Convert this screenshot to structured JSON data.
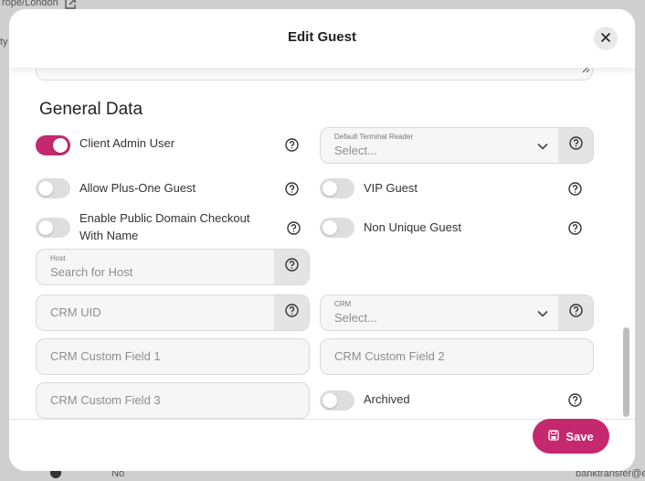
{
  "background": {
    "timezone": "rope/London",
    "column_fragment": "ty",
    "no_label": "No",
    "email_fragment": "banktransfer@e"
  },
  "modal": {
    "title": "Edit Guest",
    "section_title": "General Data"
  },
  "fields": {
    "client_admin_user": {
      "label": "Client Admin User",
      "on": true
    },
    "default_terminal_reader": {
      "label": "Default Terminal Reader",
      "placeholder": "Select..."
    },
    "allow_plus_one": {
      "label": "Allow Plus-One Guest",
      "on": false
    },
    "vip_guest": {
      "label": "VIP Guest",
      "on": false
    },
    "enable_public_domain_checkout": {
      "label": "Enable Public Domain Checkout With Name",
      "on": false
    },
    "non_unique_guest": {
      "label": "Non Unique Guest",
      "on": false
    },
    "host": {
      "label": "Host",
      "placeholder": "Search for Host"
    },
    "crm_uid": {
      "placeholder": "CRM UID"
    },
    "crm": {
      "label": "CRM",
      "placeholder": "Select..."
    },
    "crm_custom_field_1": {
      "placeholder": "CRM Custom Field 1"
    },
    "crm_custom_field_2": {
      "placeholder": "CRM Custom Field 2"
    },
    "crm_custom_field_3": {
      "placeholder": "CRM Custom Field 3"
    },
    "archived": {
      "label": "Archived",
      "on": false
    }
  },
  "footer": {
    "save_label": "Save"
  },
  "colors": {
    "accent": "#c4286e",
    "toggle_off": "#dedede",
    "field_bg": "#f6f6f6"
  }
}
